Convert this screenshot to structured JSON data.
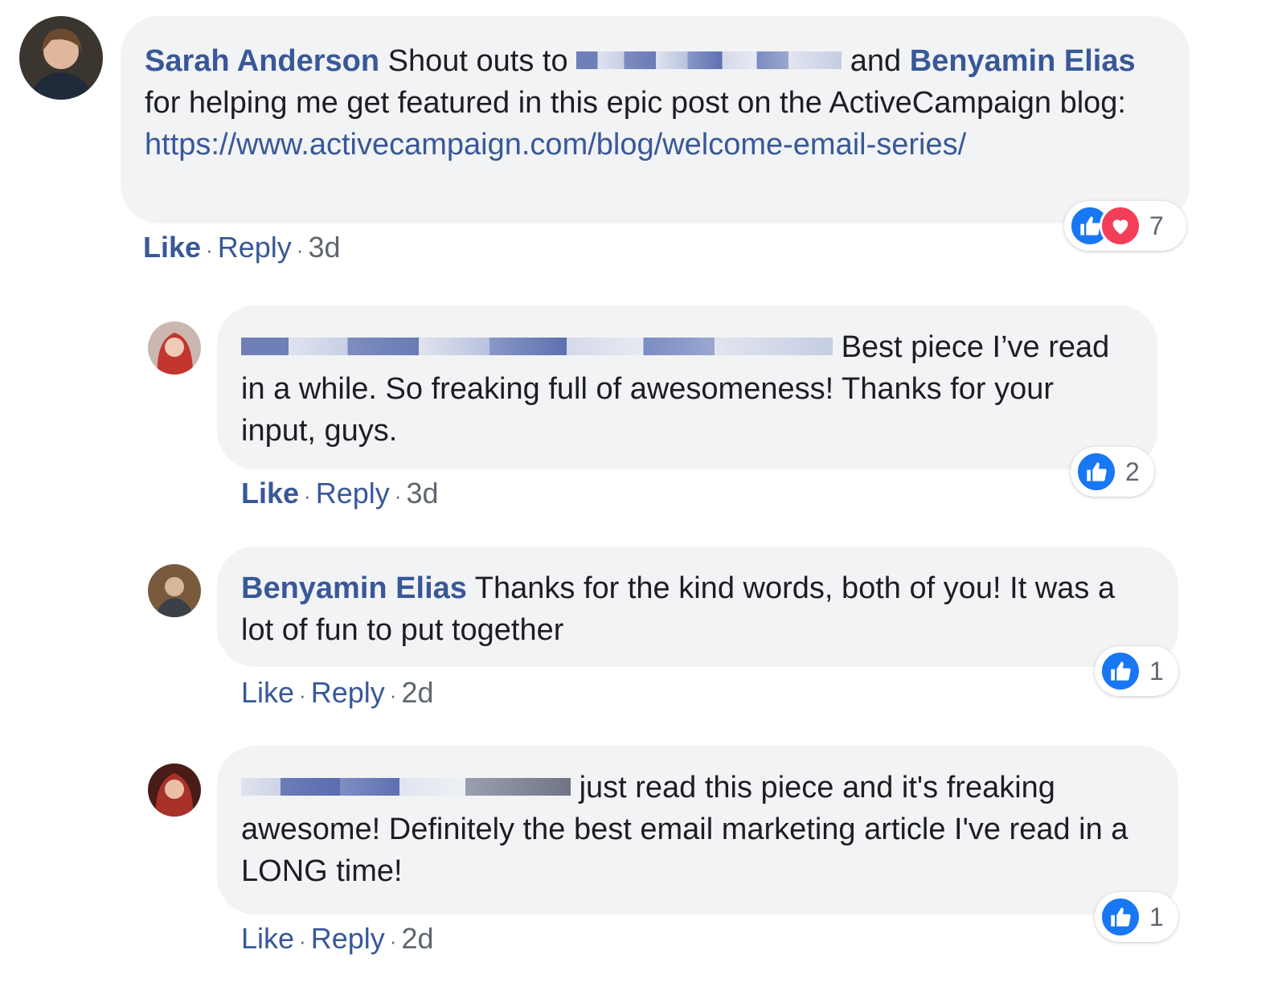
{
  "colors": {
    "author_blue": "#385898",
    "bubble_bg": "#f2f3f5",
    "like_blue": "#1877f2",
    "love_red": "#f33e58",
    "meta_gray": "#606770"
  },
  "comments": [
    {
      "author": "Sarah Anderson",
      "text_before": "Shout outs to",
      "text_mid": "and",
      "mention": "Benyamin Elias",
      "text_after": "for helping me get featured in this epic post on the ActiveCampaign blog:",
      "link": "https://www.activecampaign.com/blog/welcome-email-series/",
      "like_label": "Like",
      "reply_label": "Reply",
      "time": "3d",
      "reaction_count": "7",
      "reaction_icons": [
        "like-icon",
        "love-icon"
      ]
    },
    {
      "text": "Best piece I’ve read in a while. So freaking full of awesomeness! Thanks for your input, guys.",
      "like_label": "Like",
      "reply_label": "Reply",
      "time": "3d",
      "reaction_count": "2",
      "reaction_icons": [
        "like-icon"
      ]
    },
    {
      "author": "Benyamin Elias",
      "text": "Thanks for the kind words, both of you! It was a lot of fun to put together",
      "like_label": "Like",
      "reply_label": "Reply",
      "time": "2d",
      "reaction_count": "1",
      "reaction_icons": [
        "like-icon"
      ]
    },
    {
      "text": "just read this piece and it's freaking awesome! Definitely the best email marketing article I've read in a LONG time!",
      "like_label": "Like",
      "reply_label": "Reply",
      "time": "2d",
      "reaction_count": "1",
      "reaction_icons": [
        "like-icon"
      ]
    }
  ]
}
